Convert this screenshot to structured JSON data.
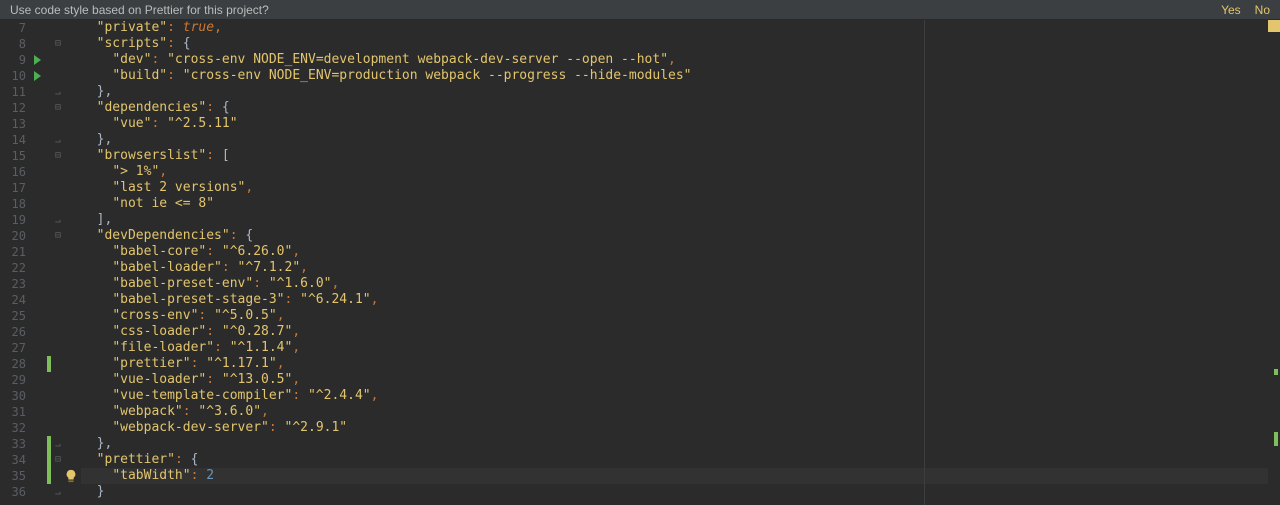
{
  "notification": {
    "message": "Use code style based on Prettier for this project?",
    "yes": "Yes",
    "no": "No"
  },
  "gutter": {
    "start": 7,
    "end": 36
  },
  "run_markers": [
    9,
    10
  ],
  "vcs_marks": [
    {
      "line": 28,
      "span": 1
    },
    {
      "line": 33,
      "span": 3
    }
  ],
  "fold_markers": {
    "open": [
      8,
      12,
      15,
      20,
      34
    ],
    "close": [
      11,
      14,
      19,
      33,
      36
    ]
  },
  "caret_line": 35,
  "bulb_line": 35,
  "code": {
    "l7": {
      "indent": 1,
      "k": "\"private\"",
      "sep": ": ",
      "v_kind": "kw",
      "v": "true",
      "t": ","
    },
    "l8": {
      "indent": 1,
      "k": "\"scripts\"",
      "sep": ": ",
      "raw_after": "{"
    },
    "l9": {
      "indent": 2,
      "k": "\"dev\"",
      "sep": ": ",
      "v_kind": "str",
      "v": "\"cross-env NODE_ENV=development webpack-dev-server --open --hot\"",
      "t": ","
    },
    "l10": {
      "indent": 2,
      "k": "\"build\"",
      "sep": ": ",
      "v_kind": "str",
      "v": "\"cross-env NODE_ENV=production webpack --progress --hide-modules\""
    },
    "l11": {
      "indent": 1,
      "raw": "},",
      "raw_kind": "pn"
    },
    "l12": {
      "indent": 1,
      "k": "\"dependencies\"",
      "sep": ": ",
      "raw_after": "{"
    },
    "l13": {
      "indent": 2,
      "k": "\"vue\"",
      "sep": ": ",
      "v_kind": "str",
      "v": "\"^2.5.11\""
    },
    "l14": {
      "indent": 1,
      "raw": "},",
      "raw_kind": "pn"
    },
    "l15": {
      "indent": 1,
      "k": "\"browserslist\"",
      "sep": ": ",
      "raw_after": "["
    },
    "l16": {
      "indent": 2,
      "v_kind": "str",
      "v": "\"> 1%\"",
      "t": ","
    },
    "l17": {
      "indent": 2,
      "v_kind": "str",
      "v": "\"last 2 versions\"",
      "t": ","
    },
    "l18": {
      "indent": 2,
      "v_kind": "str",
      "v": "\"not ie <= 8\""
    },
    "l19": {
      "indent": 1,
      "raw": "],",
      "raw_kind": "pn"
    },
    "l20": {
      "indent": 1,
      "k": "\"devDependencies\"",
      "sep": ": ",
      "raw_after": "{"
    },
    "l21": {
      "indent": 2,
      "k": "\"babel-core\"",
      "sep": ": ",
      "v_kind": "str",
      "v": "\"^6.26.0\"",
      "t": ","
    },
    "l22": {
      "indent": 2,
      "k": "\"babel-loader\"",
      "sep": ": ",
      "v_kind": "str",
      "v": "\"^7.1.2\"",
      "t": ","
    },
    "l23": {
      "indent": 2,
      "k": "\"babel-preset-env\"",
      "sep": ": ",
      "v_kind": "str",
      "v": "\"^1.6.0\"",
      "t": ","
    },
    "l24": {
      "indent": 2,
      "k": "\"babel-preset-stage-3\"",
      "sep": ": ",
      "v_kind": "str",
      "v": "\"^6.24.1\"",
      "t": ","
    },
    "l25": {
      "indent": 2,
      "k": "\"cross-env\"",
      "sep": ": ",
      "v_kind": "str",
      "v": "\"^5.0.5\"",
      "t": ","
    },
    "l26": {
      "indent": 2,
      "k": "\"css-loader\"",
      "sep": ": ",
      "v_kind": "str",
      "v": "\"^0.28.7\"",
      "t": ","
    },
    "l27": {
      "indent": 2,
      "k": "\"file-loader\"",
      "sep": ": ",
      "v_kind": "str",
      "v": "\"^1.1.4\"",
      "t": ","
    },
    "l28": {
      "indent": 2,
      "k": "\"prettier\"",
      "sep": ": ",
      "v_kind": "str",
      "v": "\"^1.17.1\"",
      "t": ","
    },
    "l29": {
      "indent": 2,
      "k": "\"vue-loader\"",
      "sep": ": ",
      "v_kind": "str",
      "v": "\"^13.0.5\"",
      "t": ","
    },
    "l30": {
      "indent": 2,
      "k": "\"vue-template-compiler\"",
      "sep": ": ",
      "v_kind": "str",
      "v": "\"^2.4.4\"",
      "t": ","
    },
    "l31": {
      "indent": 2,
      "k": "\"webpack\"",
      "sep": ": ",
      "v_kind": "str",
      "v": "\"^3.6.0\"",
      "t": ","
    },
    "l32": {
      "indent": 2,
      "k": "\"webpack-dev-server\"",
      "sep": ": ",
      "v_kind": "str",
      "v": "\"^2.9.1\""
    },
    "l33": {
      "indent": 1,
      "raw": "},",
      "raw_kind": "pn"
    },
    "l34": {
      "indent": 1,
      "k": "\"prettier\"",
      "sep": ": ",
      "raw_after": "{"
    },
    "l35": {
      "indent": 2,
      "k": "\"tabWidth\"",
      "sep": ": ",
      "v_kind": "num",
      "v": "2"
    },
    "l36": {
      "indent": 1,
      "raw": "}",
      "raw_kind": "pn"
    }
  },
  "scroll_strip": {
    "segments": [
      {
        "top_pct": 72,
        "h": 6
      },
      {
        "top_pct": 85,
        "h": 14
      }
    ]
  }
}
